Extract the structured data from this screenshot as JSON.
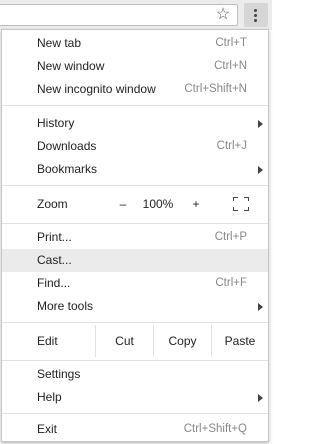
{
  "toolbar": {
    "bookmark_icon": "star-icon",
    "menu_icon": "vertical-dots-icon"
  },
  "menu": {
    "new_tab": {
      "label": "New tab",
      "shortcut": "Ctrl+T"
    },
    "new_window": {
      "label": "New window",
      "shortcut": "Ctrl+N"
    },
    "new_incognito": {
      "label": "New incognito window",
      "shortcut": "Ctrl+Shift+N"
    },
    "history": {
      "label": "History"
    },
    "downloads": {
      "label": "Downloads",
      "shortcut": "Ctrl+J"
    },
    "bookmarks": {
      "label": "Bookmarks"
    },
    "zoom": {
      "label": "Zoom",
      "minus": "–",
      "level": "100%",
      "plus": "+",
      "fullscreen_icon": "fullscreen-icon"
    },
    "print": {
      "label": "Print...",
      "shortcut": "Ctrl+P"
    },
    "cast": {
      "label": "Cast...",
      "highlighted": true
    },
    "find": {
      "label": "Find...",
      "shortcut": "Ctrl+F"
    },
    "more_tools": {
      "label": "More tools"
    },
    "edit": {
      "label": "Edit",
      "cut": "Cut",
      "copy": "Copy",
      "paste": "Paste"
    },
    "settings": {
      "label": "Settings"
    },
    "help": {
      "label": "Help"
    },
    "exit": {
      "label": "Exit",
      "shortcut": "Ctrl+Shift+Q"
    }
  },
  "colors": {
    "highlight": "#ebebeb",
    "shortcut_text": "#888888",
    "separator": "#e2e2e2"
  }
}
